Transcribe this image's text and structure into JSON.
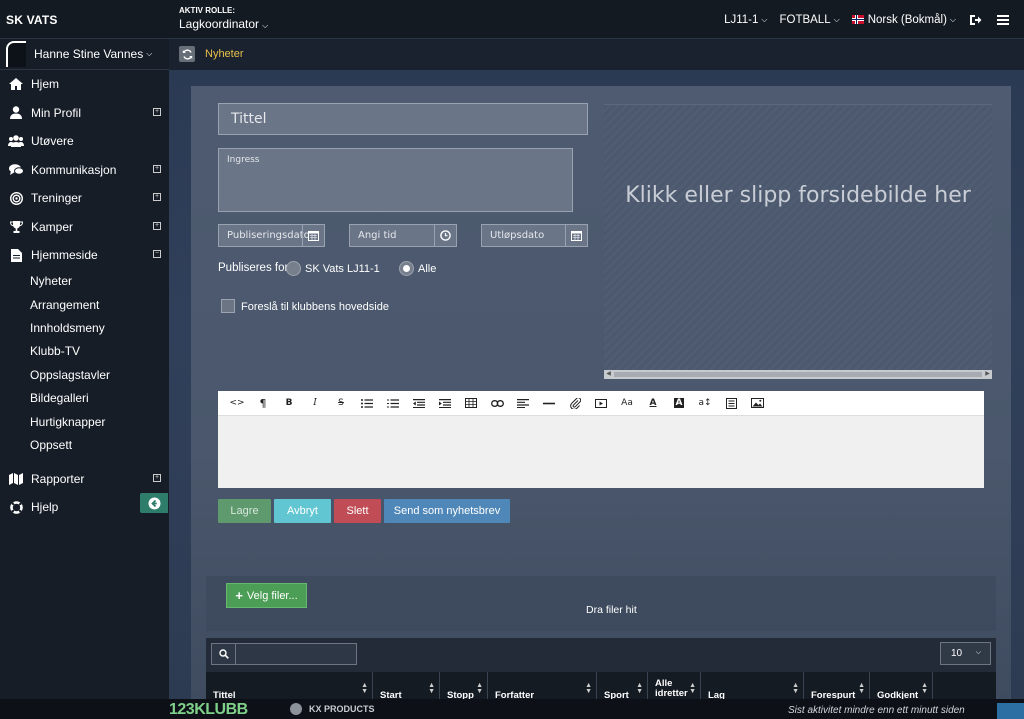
{
  "topbar": {
    "brand": "SK VATS",
    "role_caption": "AKTIV ROLLE:",
    "role_value": "Lagkoordinator",
    "team": "LJ11-1",
    "sport": "FOTBALL",
    "language": "Norsk (Bokmål)"
  },
  "sidebar": {
    "user_name": "Hanne Stine Vannes",
    "items": [
      {
        "label": "Hjem",
        "icon": "home-icon"
      },
      {
        "label": "Min Profil",
        "icon": "user-icon"
      },
      {
        "label": "Utøvere",
        "icon": "users-icon"
      },
      {
        "label": "Kommunikasjon",
        "icon": "chat-icon"
      },
      {
        "label": "Treninger",
        "icon": "target-icon"
      },
      {
        "label": "Kamper",
        "icon": "trophy-icon"
      },
      {
        "label": "Hjemmeside",
        "icon": "document-icon"
      },
      {
        "label": "Rapporter",
        "icon": "map-icon"
      },
      {
        "label": "Hjelp",
        "icon": "lifebuoy-icon"
      }
    ],
    "sub_items": [
      "Nyheter",
      "Arrangement",
      "Innholdsmeny",
      "Klubb-TV",
      "Oppslagstavler",
      "Bildegalleri",
      "Hurtigknapper",
      "Oppsett"
    ]
  },
  "breadcrumb": {
    "current": "Nyheter"
  },
  "form": {
    "title_placeholder": "Tittel",
    "ingress_placeholder": "Ingress",
    "publish_date_placeholder": "Publiseringsdato",
    "time_placeholder": "Angi tid",
    "expiry_placeholder": "Utløpsdato",
    "publish_for_label": "Publiseres for:",
    "option_team": "SK Vats LJ11-1",
    "option_all": "Alle",
    "selected_option": "Alle",
    "suggest_label": "Foreslå til klubbens hovedside",
    "suggest_checked": false,
    "image_drop_text": "Klikk eller slipp forsidebilde her"
  },
  "editor": {
    "tools": [
      "code-view-icon",
      "paragraph-icon",
      "bold-icon",
      "italic-icon",
      "strikethrough-icon",
      "bulleted-list-icon",
      "numbered-list-icon",
      "outdent-icon",
      "indent-icon",
      "table-icon",
      "link-icon",
      "align-icon",
      "horizontal-rule-icon",
      "attach-icon",
      "video-icon",
      "font-size-icon",
      "font-color-icon",
      "background-color-icon",
      "text-size-icon",
      "template-icon",
      "image-icon"
    ]
  },
  "actions": {
    "save": "Lagre",
    "cancel": "Avbryt",
    "delete": "Slett",
    "send": "Send som nyhetsbrev"
  },
  "files": {
    "choose_label": "Velg filer...",
    "drop_label": "Dra filer hit"
  },
  "table": {
    "page_size": "10",
    "columns": [
      "Tittel",
      "Start",
      "Stopp",
      "Forfatter",
      "Sport",
      "Alle idretter",
      "Lag",
      "Forespurt",
      "Godkjent"
    ]
  },
  "footer": {
    "logo_main": "123KLUBB",
    "logo_partner": "KX PRODUCTS",
    "last_activity": "Sist aktivitet  mindre enn ett minutt siden"
  },
  "colors": {
    "accent_yellow": "#e8c24a",
    "save_green": "#5e9a6e",
    "cancel_cyan": "#62c6d2",
    "delete_red": "#c04c56",
    "send_blue": "#4f87b8",
    "files_green": "#4c9e56"
  }
}
